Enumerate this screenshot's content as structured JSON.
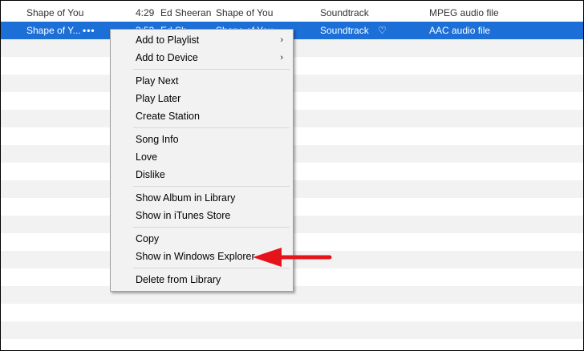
{
  "tracks": [
    {
      "name": "Shape of You",
      "time": "4:29",
      "artist": "Ed Sheeran",
      "album": "Shape of You",
      "genre": "Soundtrack",
      "kind": "MPEG audio file",
      "selected": false
    },
    {
      "name": "Shape of Y...",
      "more": "•••",
      "time": "3:53",
      "artist": "Ed Sh",
      "album": "Shape of You",
      "genre": "Soundtrack",
      "heart": "♡",
      "kind": "AAC audio file",
      "selected": true
    }
  ],
  "context_menu": {
    "items": [
      {
        "label": "Add to Playlist",
        "submenu": true
      },
      {
        "label": "Add to Device",
        "submenu": true
      },
      {
        "label": "Play Next"
      },
      {
        "label": "Play Later"
      },
      {
        "label": "Create Station"
      },
      {
        "label": "Song Info"
      },
      {
        "label": "Love"
      },
      {
        "label": "Dislike"
      },
      {
        "label": "Show Album in Library"
      },
      {
        "label": "Show in iTunes Store"
      },
      {
        "label": "Copy"
      },
      {
        "label": "Show in Windows Explorer",
        "highlighted_by_arrow": true
      },
      {
        "label": "Delete from Library"
      }
    ],
    "submenu_glyph": "›"
  },
  "colors": {
    "selection": "#1c6fd6",
    "alt_row": "#f2f2f2",
    "menu_bg": "#f2f2f2",
    "arrow": "#e5141b"
  }
}
